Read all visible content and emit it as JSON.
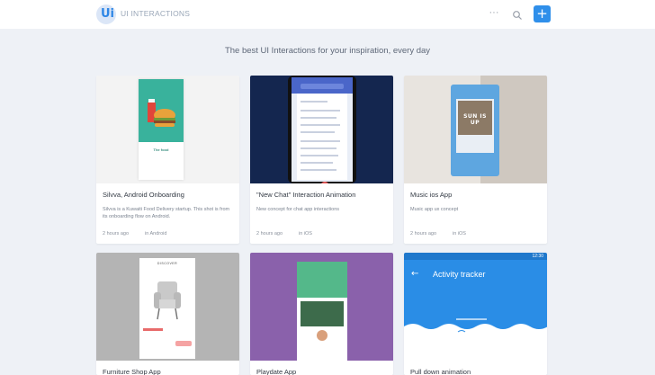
{
  "header": {
    "logo_text": "Ui",
    "brand": "UI INTERACTIONS",
    "more_label": "···",
    "add_label": "+"
  },
  "tagline": "The best UI Interactions for your inspiration, every day",
  "cards": [
    {
      "title": "Silvva, Android Onboarding",
      "description": "Silvva is a Kuwaiti Food Delivery startup. This shot is from its onboarding flow on Android.",
      "time": "2 hours ago",
      "category": "in Android",
      "thumb_title": "The food"
    },
    {
      "title": "\"New Chat\" Interaction Animation",
      "description": "New concept for chat app interactions",
      "time": "2 hours ago",
      "category": "in iOS"
    },
    {
      "title": "Music ios App",
      "description": "Music app ux concept",
      "time": "2 hours ago",
      "category": "in iOS",
      "thumb_text": "SUN IS UP"
    },
    {
      "title": "Furniture Shop App",
      "thumb_title": "DISCOVER"
    },
    {
      "title": "Playdate App"
    },
    {
      "title": "Pull down animation",
      "thumb_title": "Activity tracker",
      "thumb_time": "12:30"
    }
  ],
  "colors": {
    "accent": "#2f8fea",
    "background": "#eef1f6"
  }
}
